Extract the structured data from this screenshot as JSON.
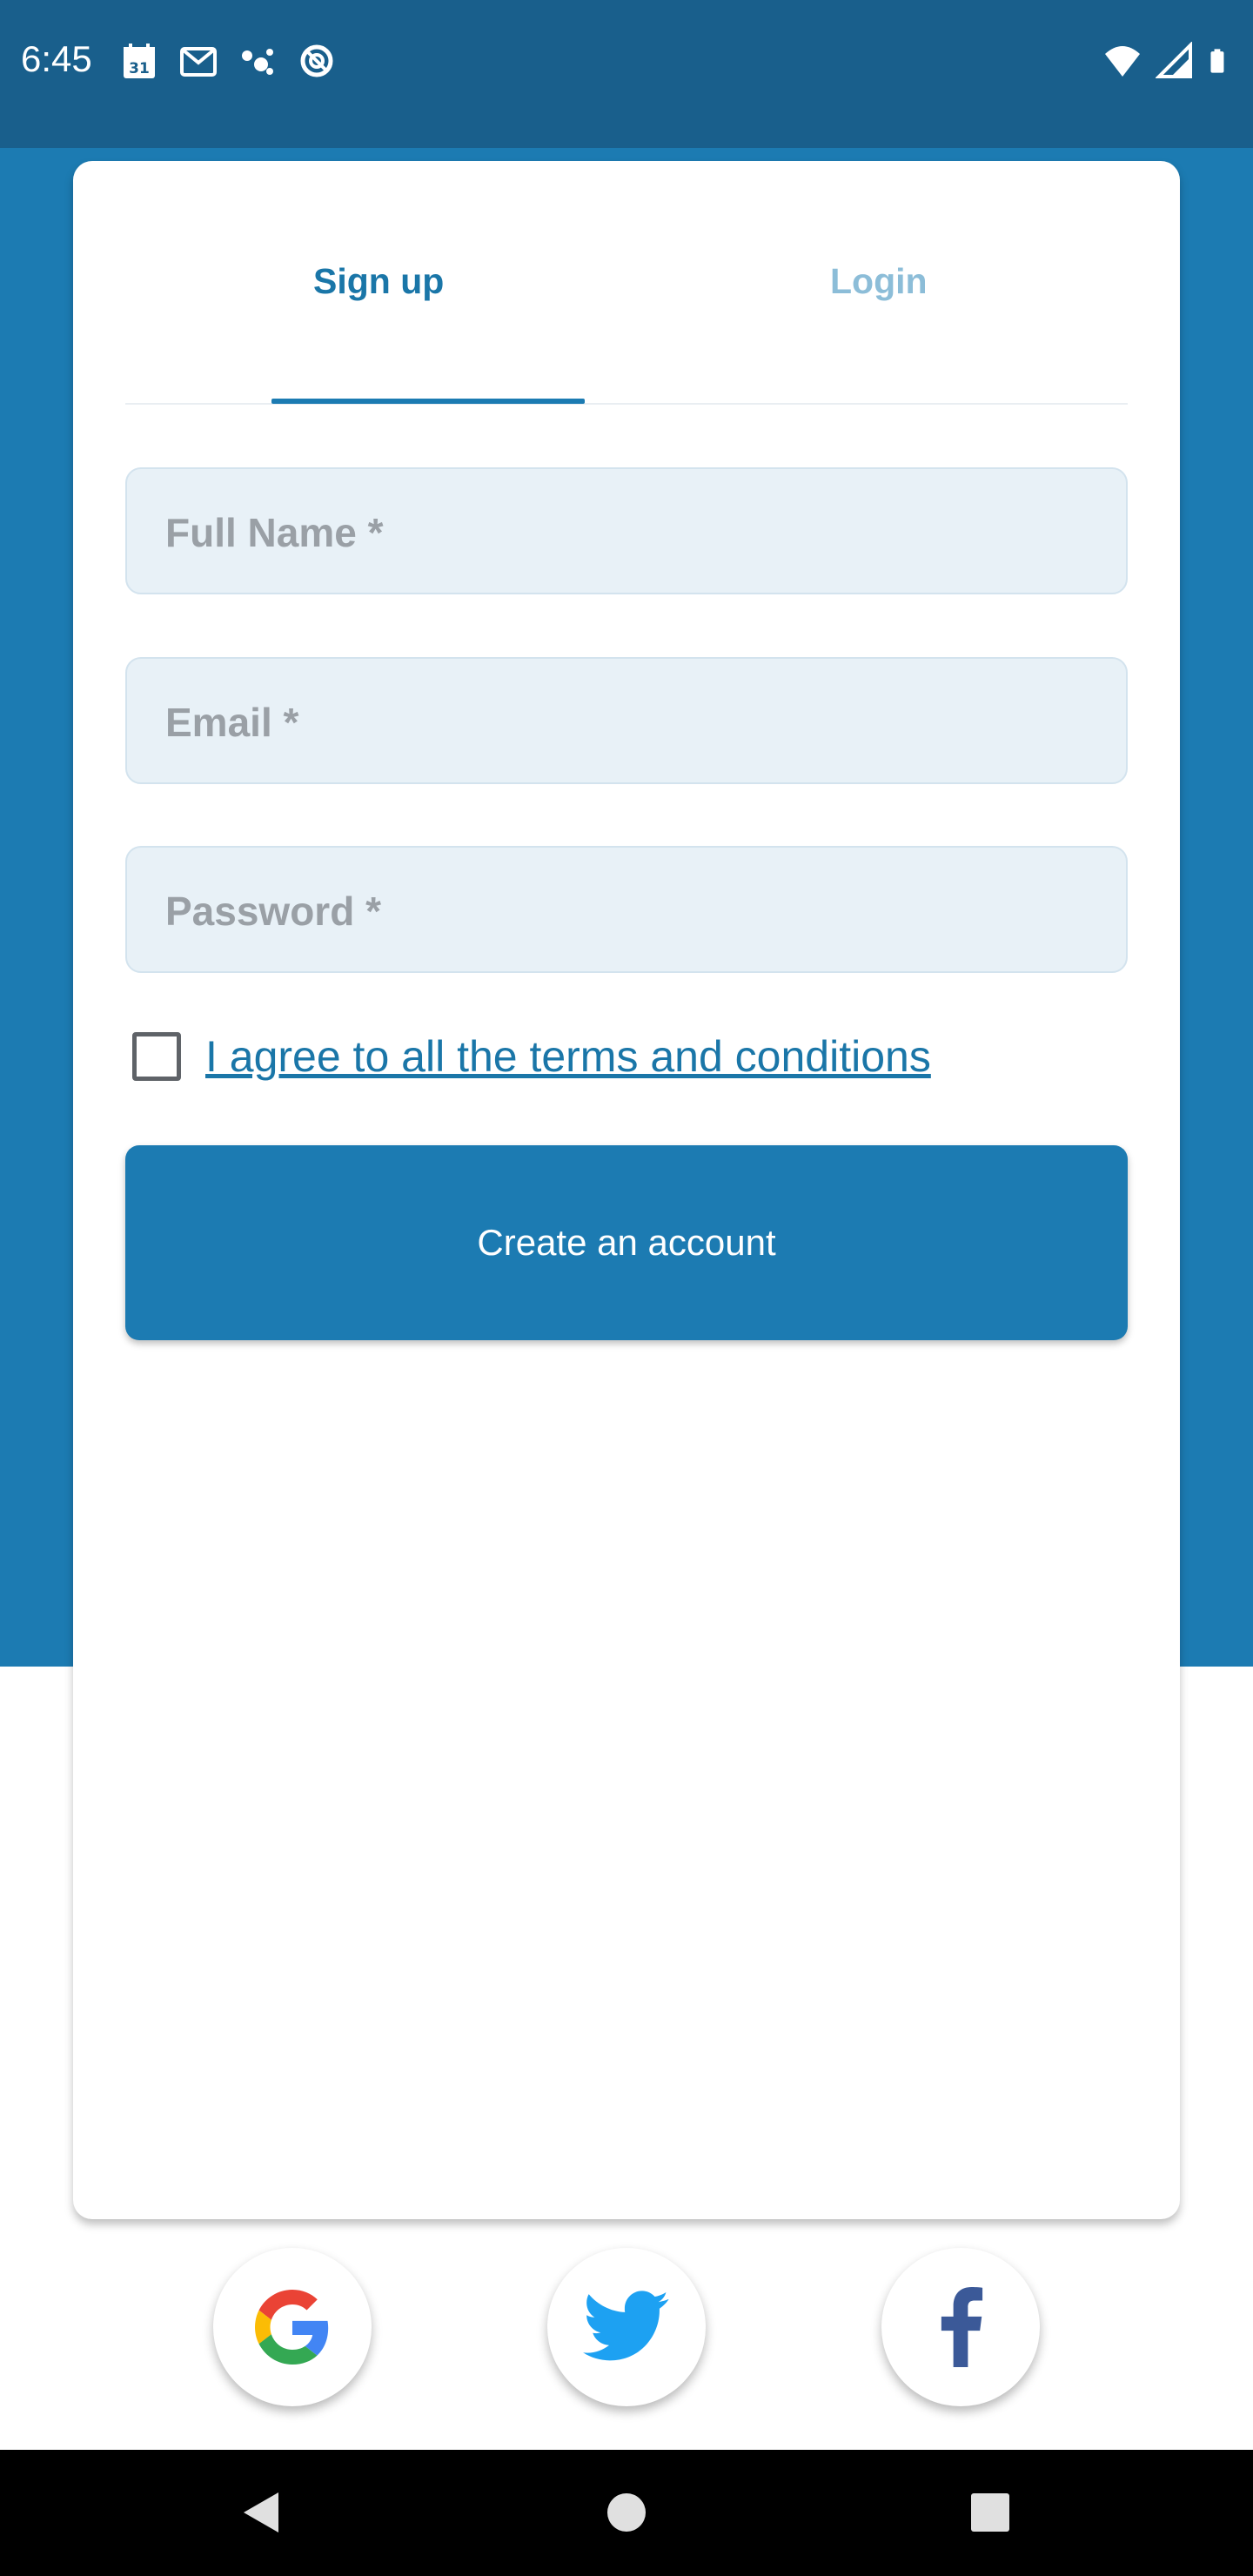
{
  "status_bar": {
    "time": "6:45",
    "left_icons": [
      "calendar-icon",
      "gmail-icon",
      "assistant-icon",
      "data-saver-icon"
    ],
    "right_icons": [
      "wifi-icon",
      "cell-signal-icon",
      "battery-icon"
    ],
    "calendar_day": "31",
    "background": "#195f8c"
  },
  "tabs": [
    {
      "label": "Sign up",
      "selected": true
    },
    {
      "label": "Login",
      "selected": false
    }
  ],
  "form": {
    "full_name": {
      "placeholder": "Full Name *",
      "value": ""
    },
    "email": {
      "placeholder": "Email *",
      "value": ""
    },
    "password": {
      "placeholder": "Password *",
      "value": ""
    },
    "terms_label": "I agree to all the terms and conditions",
    "terms_checked": false,
    "submit_label": "Create an account"
  },
  "social": [
    "google-icon",
    "twitter-icon",
    "facebook-icon"
  ],
  "nav": [
    "back-icon",
    "home-icon",
    "recents-icon"
  ],
  "colors": {
    "primary": "#1c7bb2",
    "tab_active": "#1a76a8",
    "tab_inactive": "#8cbdd8",
    "field_bg": "#e8f1f7",
    "placeholder": "#9aa0a6"
  }
}
